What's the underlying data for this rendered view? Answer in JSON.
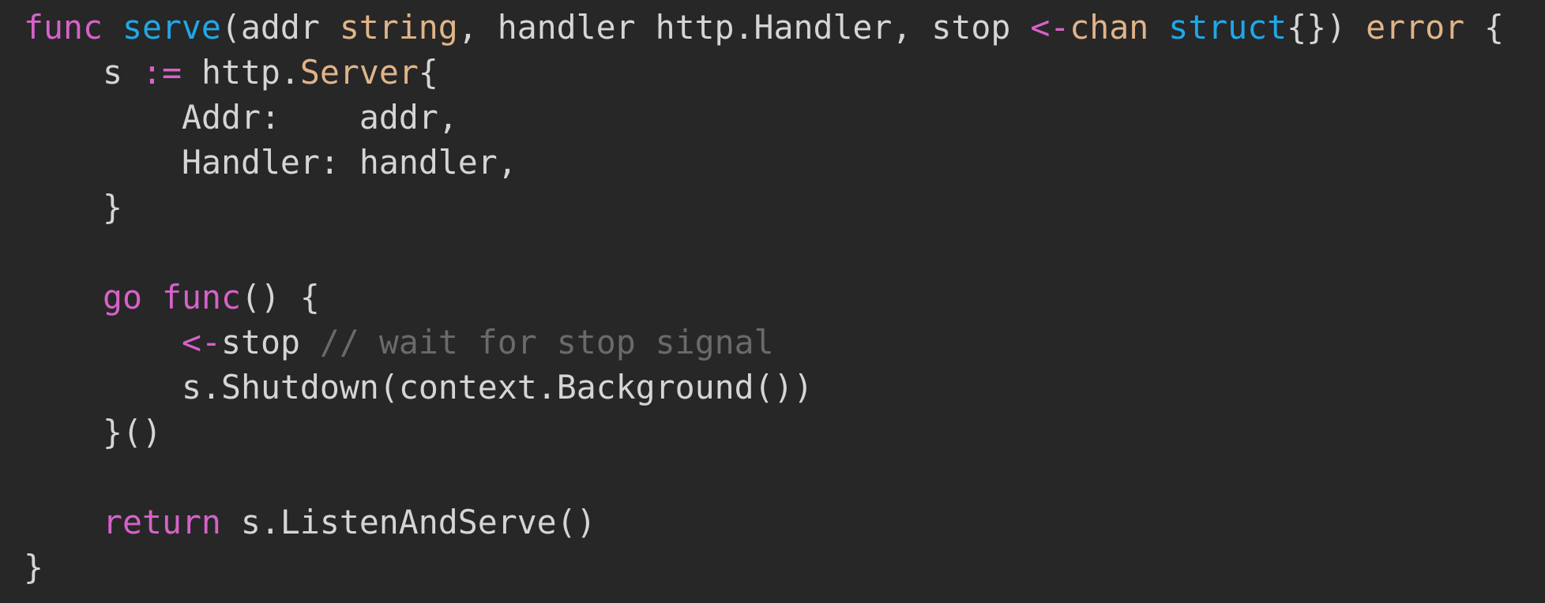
{
  "colors": {
    "background": "#272727",
    "plain": "#d5d5d5",
    "keyword": "#d662c8",
    "function": "#1fa8e8",
    "type": "#e0b489",
    "comment": "#6a6a6a"
  },
  "lines": [
    {
      "indent": 0,
      "tokens": [
        {
          "text": "func",
          "kind": "keyword"
        },
        {
          "text": " ",
          "kind": "plain"
        },
        {
          "text": "serve",
          "kind": "function"
        },
        {
          "text": "(addr ",
          "kind": "plain"
        },
        {
          "text": "string",
          "kind": "type"
        },
        {
          "text": ", handler http.Handler, stop ",
          "kind": "plain"
        },
        {
          "text": "<-",
          "kind": "keyword"
        },
        {
          "text": "chan",
          "kind": "type"
        },
        {
          "text": " ",
          "kind": "plain"
        },
        {
          "text": "struct",
          "kind": "function"
        },
        {
          "text": "{}) ",
          "kind": "plain"
        },
        {
          "text": "error",
          "kind": "type"
        },
        {
          "text": " {",
          "kind": "plain"
        }
      ]
    },
    {
      "indent": 1,
      "tokens": [
        {
          "text": "s ",
          "kind": "plain"
        },
        {
          "text": ":=",
          "kind": "keyword"
        },
        {
          "text": " http.",
          "kind": "plain"
        },
        {
          "text": "Server",
          "kind": "type"
        },
        {
          "text": "{",
          "kind": "plain"
        }
      ]
    },
    {
      "indent": 2,
      "tokens": [
        {
          "text": "Addr:    addr,",
          "kind": "plain"
        }
      ]
    },
    {
      "indent": 2,
      "tokens": [
        {
          "text": "Handler: handler,",
          "kind": "plain"
        }
      ]
    },
    {
      "indent": 1,
      "tokens": [
        {
          "text": "}",
          "kind": "plain"
        }
      ]
    },
    {
      "indent": 0,
      "tokens": []
    },
    {
      "indent": 1,
      "tokens": [
        {
          "text": "go",
          "kind": "keyword"
        },
        {
          "text": " ",
          "kind": "plain"
        },
        {
          "text": "func",
          "kind": "keyword"
        },
        {
          "text": "() {",
          "kind": "plain"
        }
      ]
    },
    {
      "indent": 2,
      "tokens": [
        {
          "text": "<-",
          "kind": "keyword"
        },
        {
          "text": "stop ",
          "kind": "plain"
        },
        {
          "text": "// wait for stop signal",
          "kind": "comment"
        }
      ]
    },
    {
      "indent": 2,
      "tokens": [
        {
          "text": "s.Shutdown(context.Background())",
          "kind": "plain"
        }
      ]
    },
    {
      "indent": 1,
      "tokens": [
        {
          "text": "}()",
          "kind": "plain"
        }
      ]
    },
    {
      "indent": 0,
      "tokens": []
    },
    {
      "indent": 1,
      "tokens": [
        {
          "text": "return",
          "kind": "keyword"
        },
        {
          "text": " s.ListenAndServe()",
          "kind": "plain"
        }
      ]
    },
    {
      "indent": 0,
      "tokens": [
        {
          "text": "}",
          "kind": "plain"
        }
      ]
    }
  ]
}
